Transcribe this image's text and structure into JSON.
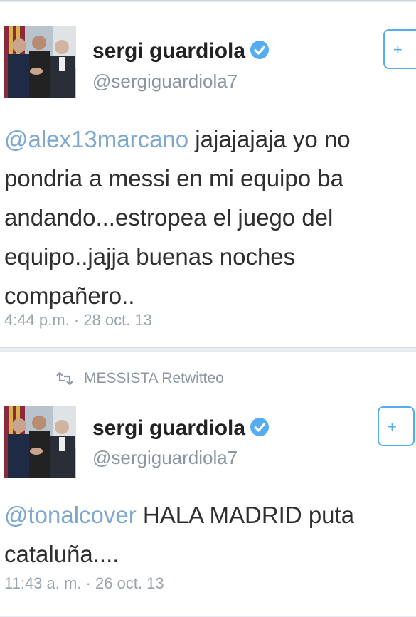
{
  "tweets": [
    {
      "name": "sergi guardiola",
      "handle": "@sergiguardiola7",
      "follow_label": "+",
      "mention": "@alex13marcano",
      "body": " jajajajaja yo no pondria a messi en mi equipo ba andando...estropea el juego del equipo..jajja buenas noches compañero..",
      "timestamp": "4:44 p.m. · 28 oct. 13"
    },
    {
      "retweet_label": "MESSISTA Retwitteo",
      "name": "sergi guardiola",
      "handle": "@sergiguardiola7",
      "follow_label": "+",
      "mention": "@tonalcover",
      "body": " HALA MADRID puta cataluña....",
      "timestamp": "11:43 a. m. · 26 oct. 13"
    }
  ],
  "colors": {
    "link": "#7fa8cf",
    "verified": "#55acee",
    "muted": "#8c96a1"
  },
  "icons": [
    "verified-icon",
    "retweet-icon",
    "avatar-photo"
  ]
}
